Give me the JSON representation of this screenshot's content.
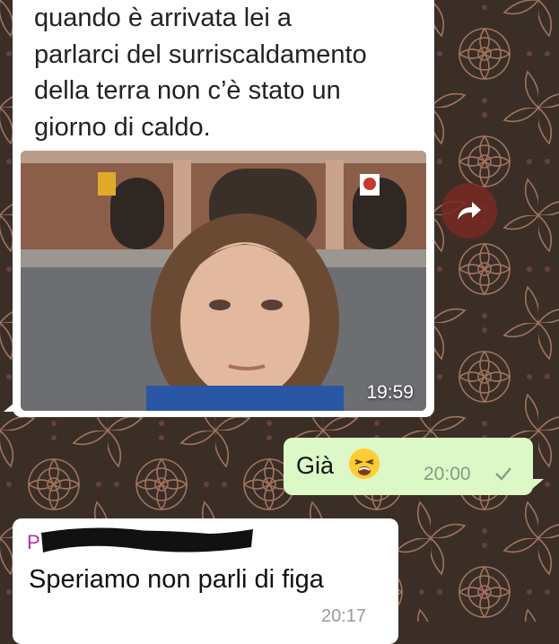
{
  "chat": {
    "messages": [
      {
        "direction": "incoming",
        "kind": "image",
        "text": "quando è arrivata lei a\nparlarci del surriscaldamento\ndella terra non c’è  stato un\ngiorno di caldo.",
        "time": "19:59"
      },
      {
        "direction": "outgoing",
        "text": "Già",
        "emoji": "weary-face",
        "time": "20:00",
        "status_icon": "check-icon"
      },
      {
        "direction": "incoming",
        "sender": "P",
        "text": "Speriamo non parli di figa",
        "time": "20:17"
      }
    ]
  },
  "colors": {
    "outgoing_bubble": "#dcf8c6",
    "incoming_bubble": "#ffffff",
    "sender_name": "#b32fa0",
    "forward_button": "#782823",
    "wallpaper": "#3a2e27"
  },
  "icons": {
    "forward": "forward-arrow-icon",
    "read_status": "check-icon"
  }
}
